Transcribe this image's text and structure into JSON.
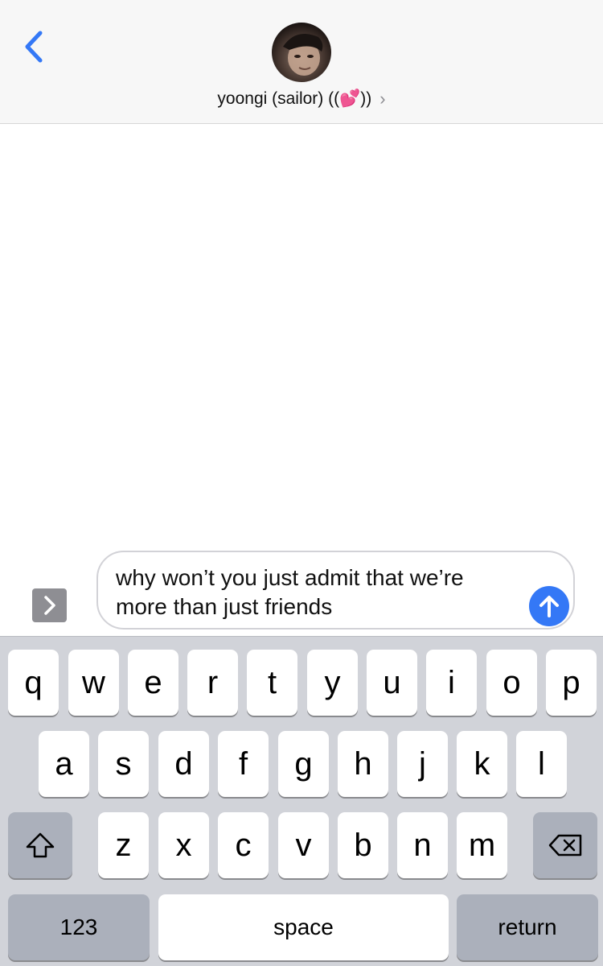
{
  "header": {
    "back_icon": "chevron-left-icon",
    "contact_name": "yoongi (sailor) ((💕))",
    "chevron": "›",
    "accent_color": "#3478f6"
  },
  "composer": {
    "apps_icon": "chevron-right-icon",
    "message_text": "why won’t you just admit that we’re more than just friends",
    "send_icon": "arrow-up-icon"
  },
  "keyboard": {
    "row1": [
      "q",
      "w",
      "e",
      "r",
      "t",
      "y",
      "u",
      "i",
      "o",
      "p"
    ],
    "row2": [
      "a",
      "s",
      "d",
      "f",
      "g",
      "h",
      "j",
      "k",
      "l"
    ],
    "row3": [
      "z",
      "x",
      "c",
      "v",
      "b",
      "n",
      "m"
    ],
    "shift_icon": "shift-icon",
    "delete_icon": "backspace-icon",
    "numbers_label": "123",
    "space_label": "space",
    "return_label": "return"
  }
}
